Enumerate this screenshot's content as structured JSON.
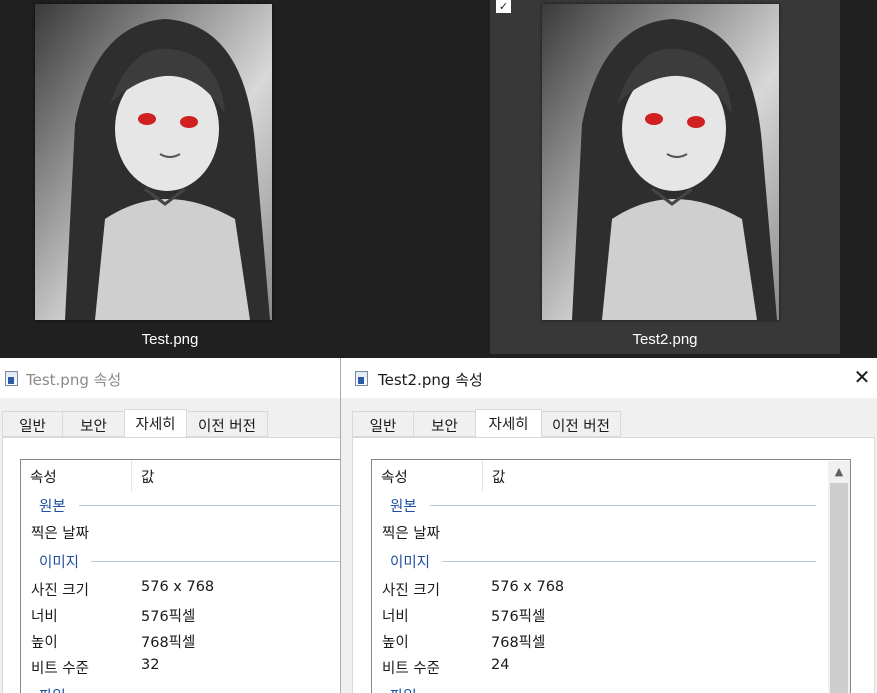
{
  "explorer": {
    "files": [
      {
        "name": "Test.png",
        "selected": false
      },
      {
        "name": "Test2.png",
        "selected": true
      }
    ]
  },
  "dialogs": [
    {
      "title": "Test.png 속성",
      "active": false,
      "tabs": [
        "일반",
        "보안",
        "자세히",
        "이전 버전"
      ],
      "active_tab": "자세히",
      "columns": [
        "속성",
        "값"
      ],
      "groups": [
        {
          "label": "원본",
          "rows": [
            {
              "name": "찍은 날짜",
              "value": ""
            }
          ]
        },
        {
          "label": "이미지",
          "rows": [
            {
              "name": "사진 크기",
              "value": "576 x 768"
            },
            {
              "name": "너비",
              "value": "576픽셀"
            },
            {
              "name": "높이",
              "value": "768픽셀"
            },
            {
              "name": "비트 수준",
              "value": "32"
            }
          ]
        },
        {
          "label": "파일"
        }
      ]
    },
    {
      "title": "Test2.png 속성",
      "active": true,
      "close_icon": "close-icon",
      "tabs": [
        "일반",
        "보안",
        "자세히",
        "이전 버전"
      ],
      "active_tab": "자세히",
      "columns": [
        "속성",
        "값"
      ],
      "groups": [
        {
          "label": "원본",
          "rows": [
            {
              "name": "찍은 날짜",
              "value": ""
            }
          ]
        },
        {
          "label": "이미지",
          "rows": [
            {
              "name": "사진 크기",
              "value": "576 x 768"
            },
            {
              "name": "너비",
              "value": "576픽셀"
            },
            {
              "name": "높이",
              "value": "768픽셀"
            },
            {
              "name": "비트 수준",
              "value": "24"
            }
          ]
        },
        {
          "label": "파일"
        }
      ]
    }
  ],
  "colors": {
    "explorer_bg": "#202020",
    "selected_tile": "#383838",
    "group_text": "#1e4fa0",
    "dialog_bg": "#f0f0f0"
  }
}
